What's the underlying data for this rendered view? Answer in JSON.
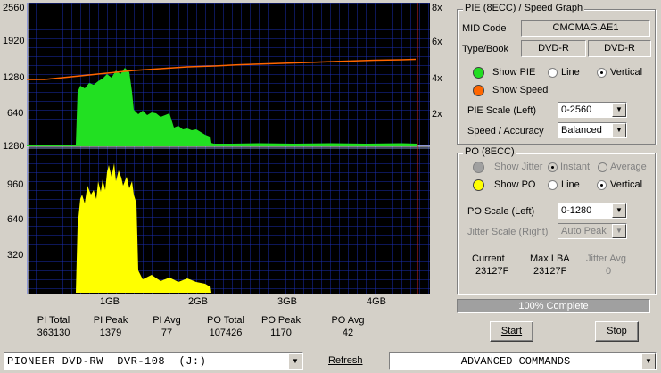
{
  "graph": {
    "top_left_ticks": [
      "2560",
      "1920",
      "1280",
      "640"
    ],
    "top_right_ticks": [
      "8x",
      "6x",
      "4x",
      "2x"
    ],
    "bottom_left_ticks": [
      "1280",
      "960",
      "640",
      "320"
    ],
    "x_ticks": [
      "1GB",
      "2GB",
      "3GB",
      "4GB"
    ]
  },
  "pie_group": {
    "title": "PIE (8ECC) / Speed Graph",
    "mid_label": "MID Code",
    "mid_value": "CMCMAG.AE1",
    "type_label": "Type/Book",
    "type_value": "DVD-R",
    "book_value": "DVD-R",
    "show_pie": "Show PIE",
    "show_speed": "Show Speed",
    "line": "Line",
    "vertical": "Vertical",
    "scale_label": "PIE Scale (Left)",
    "scale_value": "0-2560",
    "accuracy_label": "Speed / Accuracy",
    "accuracy_value": "Balanced",
    "pie_color": "#22cc22",
    "speed_color": "#ff6600"
  },
  "po_group": {
    "title": "PO (8ECC)",
    "show_jitter": "Show Jitter",
    "instant": "Instant",
    "average": "Average",
    "show_po": "Show PO",
    "line": "Line",
    "vertical": "Vertical",
    "scale_label": "PO Scale (Left)",
    "scale_value": "0-1280",
    "jitter_label": "Jitter Scale (Right)",
    "jitter_value": "Auto Peak",
    "current_label": "Current",
    "current_value": "23127F",
    "maxlba_label": "Max LBA",
    "maxlba_value": "23127F",
    "jitter_avg_label": "Jitter Avg",
    "jitter_avg_value": "0",
    "po_color": "#ffff00"
  },
  "progress": {
    "text": "100% Complete",
    "value": 1.0
  },
  "buttons": {
    "start": "Start",
    "stop": "Stop",
    "refresh": "Refresh"
  },
  "stats": [
    {
      "label": "PI Total",
      "value": "363130"
    },
    {
      "label": "PI Peak",
      "value": "1379"
    },
    {
      "label": "PI Avg",
      "value": "77"
    },
    {
      "label": "PO Total",
      "value": "107426"
    },
    {
      "label": "PO Peak",
      "value": "1170"
    },
    {
      "label": "PO Avg",
      "value": "42"
    }
  ],
  "drive": {
    "value": "PIONEER DVD-RW  DVR-108  (J:)"
  },
  "commands": {
    "value": "ADVANCED COMMANDS"
  }
}
